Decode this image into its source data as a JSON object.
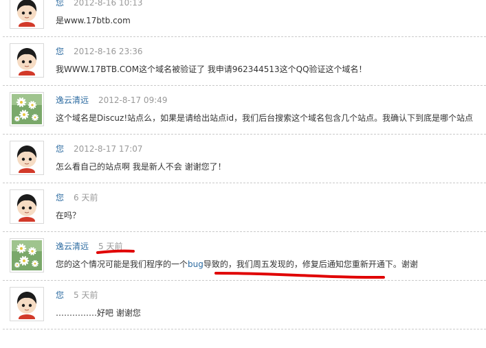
{
  "comments": [
    {
      "author": "您",
      "time": "2012-8-16 10:13",
      "avatar_icon": "cartoon-child-avatar-icon",
      "parts": [
        {
          "text": "是www.17btb.com"
        }
      ]
    },
    {
      "author": "您",
      "time": "2012-8-16 23:36",
      "avatar_icon": "cartoon-child-avatar-icon",
      "parts": [
        {
          "text": "我WWW.17BTB.COM这个域名被验证了  我申请962344513这个QQ验证这个域名！"
        }
      ]
    },
    {
      "author": "逸云清远",
      "time": "2012-8-17 09:49",
      "avatar_icon": "daisy-flowers-avatar-icon",
      "parts": [
        {
          "text": "这个域名是Discuz!站点么，如果是请给出站点id，我们后台搜索这个域名包含几个站点。我确认下到底是哪个站点"
        }
      ]
    },
    {
      "author": "您",
      "time": "2012-8-17 17:07",
      "avatar_icon": "cartoon-child-avatar-icon",
      "parts": [
        {
          "text": "怎么看自己的站点啊  我是新人不会  谢谢您了！"
        }
      ]
    },
    {
      "author": "您",
      "time": "6 天前",
      "avatar_icon": "cartoon-child-avatar-icon",
      "parts": [
        {
          "text": "在吗？"
        }
      ]
    },
    {
      "author": "逸云清远",
      "time": "5 天前",
      "avatar_icon": "daisy-flowers-avatar-icon",
      "parts": [
        {
          "text": "您的这个情况可能是我们程序的一个"
        },
        {
          "text": "bug",
          "link": true
        },
        {
          "text": "导致的，我们周五发现的，修复后通知您重新开通下。谢谢"
        }
      ]
    },
    {
      "author": "您",
      "time": "5 天前",
      "avatar_icon": "cartoon-child-avatar-icon",
      "parts": [
        {
          "text": "……………好吧  谢谢您"
        }
      ]
    }
  ],
  "annotation_color": "#e00000",
  "colors": {
    "author": "#2b6aa0",
    "time": "#999999",
    "separator": "#c9c9c9"
  }
}
